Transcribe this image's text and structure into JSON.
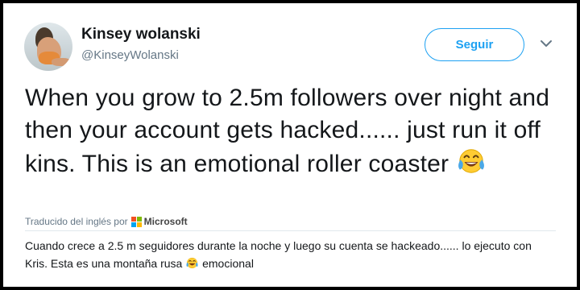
{
  "user": {
    "name": "Kinsey wolanski",
    "handle": "@KinseyWolanski"
  },
  "follow_button": {
    "label": "Seguir"
  },
  "tweet": {
    "text": "When you grow to 2.5m followers  over night and then your account gets hacked...... just run it off kins. This is an emotional roller coaster",
    "emoji": "face-with-tears-of-joy"
  },
  "translation": {
    "source_label": "Traducido del inglés por",
    "provider": "Microsoft",
    "text_before_emoji": "Cuando crece a 2.5 m seguidores durante la noche y luego su cuenta se hackeado...... lo ejecuto con Kris. Esta es una montaña rusa",
    "text_after_emoji": "emocional"
  },
  "colors": {
    "accent": "#1da1f2",
    "text": "#14171a",
    "secondary_text": "#657786",
    "frame": "#000000",
    "ms_red": "#f25022",
    "ms_green": "#7fba00",
    "ms_blue": "#00a4ef",
    "ms_yellow": "#ffb900"
  }
}
